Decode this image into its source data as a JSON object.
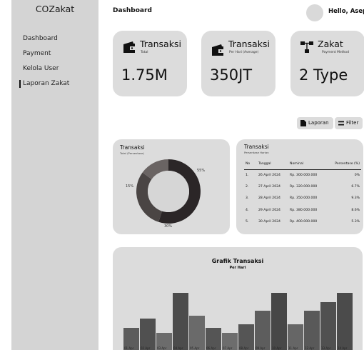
{
  "app": {
    "brand": "COZakat"
  },
  "sidebar": {
    "items": [
      {
        "label": "Dashboard"
      },
      {
        "label": "Payment"
      },
      {
        "label": "Kelola User"
      },
      {
        "label": "Laporan Zakat",
        "active": true
      }
    ]
  },
  "header": {
    "title": "Dashboard",
    "greeting": "Hello, Asep!"
  },
  "stats": [
    {
      "title": "Transaksi",
      "subtitle": "Total",
      "value": "1.75M",
      "icon": "wallet-icon"
    },
    {
      "title": "Transaksi",
      "subtitle": "Per Hari (Average)",
      "value": "350JT",
      "icon": "wallet-icon"
    },
    {
      "title": "Zakat",
      "subtitle": "Payment Method",
      "value": "2 Type",
      "icon": "hierarchy-icon"
    }
  ],
  "actions": {
    "report_label": "Laporan",
    "filter_label": "Filter"
  },
  "donut": {
    "title": "Transaksi",
    "subtitle": "Total (Persentase)",
    "segments": [
      {
        "label": "55%",
        "value": 55,
        "color": "#2b2627"
      },
      {
        "label": "30%",
        "value": 30,
        "color": "#4a4544"
      },
      {
        "label": "15%",
        "value": 15,
        "color": "#6a6463"
      }
    ]
  },
  "table": {
    "title": "Transaksi",
    "subtitle": "Persentase Harian",
    "columns": [
      "No",
      "Tanggal",
      "Nominal",
      "Persentase (%)"
    ],
    "rows": [
      [
        "1.",
        "26 April 2024",
        "Rp. 300.000.000",
        "0%"
      ],
      [
        "2.",
        "27 April 2024",
        "Rp. 320.000.000",
        "6.7%"
      ],
      [
        "3.",
        "28 April 2024",
        "Rp. 350.000.000",
        "9.3%"
      ],
      [
        "4.",
        "29 April 2024",
        "Rp. 380.000.000",
        "8.6%"
      ],
      [
        "5.",
        "30 April 2024",
        "Rp. 400.000.000",
        "5.3%"
      ]
    ]
  },
  "chart_data": {
    "type": "bar",
    "title": "Grafik Transaksi",
    "subtitle": "Per Hari",
    "categories": [
      "01 Apr",
      "02 Apr",
      "03 Apr",
      "04 Apr",
      "05 Apr",
      "06 Apr",
      "07 Apr",
      "08 Apr",
      "09 Apr",
      "10 Apr",
      "11 Apr",
      "12 Apr",
      "13 Apr",
      "14 Apr"
    ],
    "values": [
      33,
      46,
      25,
      84,
      50,
      33,
      25,
      38,
      58,
      84,
      38,
      58,
      71,
      84
    ],
    "colors": [
      "#5c5c5c",
      "#505050",
      "#6c6c6c",
      "#4c4c4c",
      "#6a6a6a",
      "#555555",
      "#6d6d6d",
      "#555555",
      "#5d5d5d",
      "#474747",
      "#666666",
      "#595959",
      "#505050",
      "#4b4b4b"
    ]
  }
}
